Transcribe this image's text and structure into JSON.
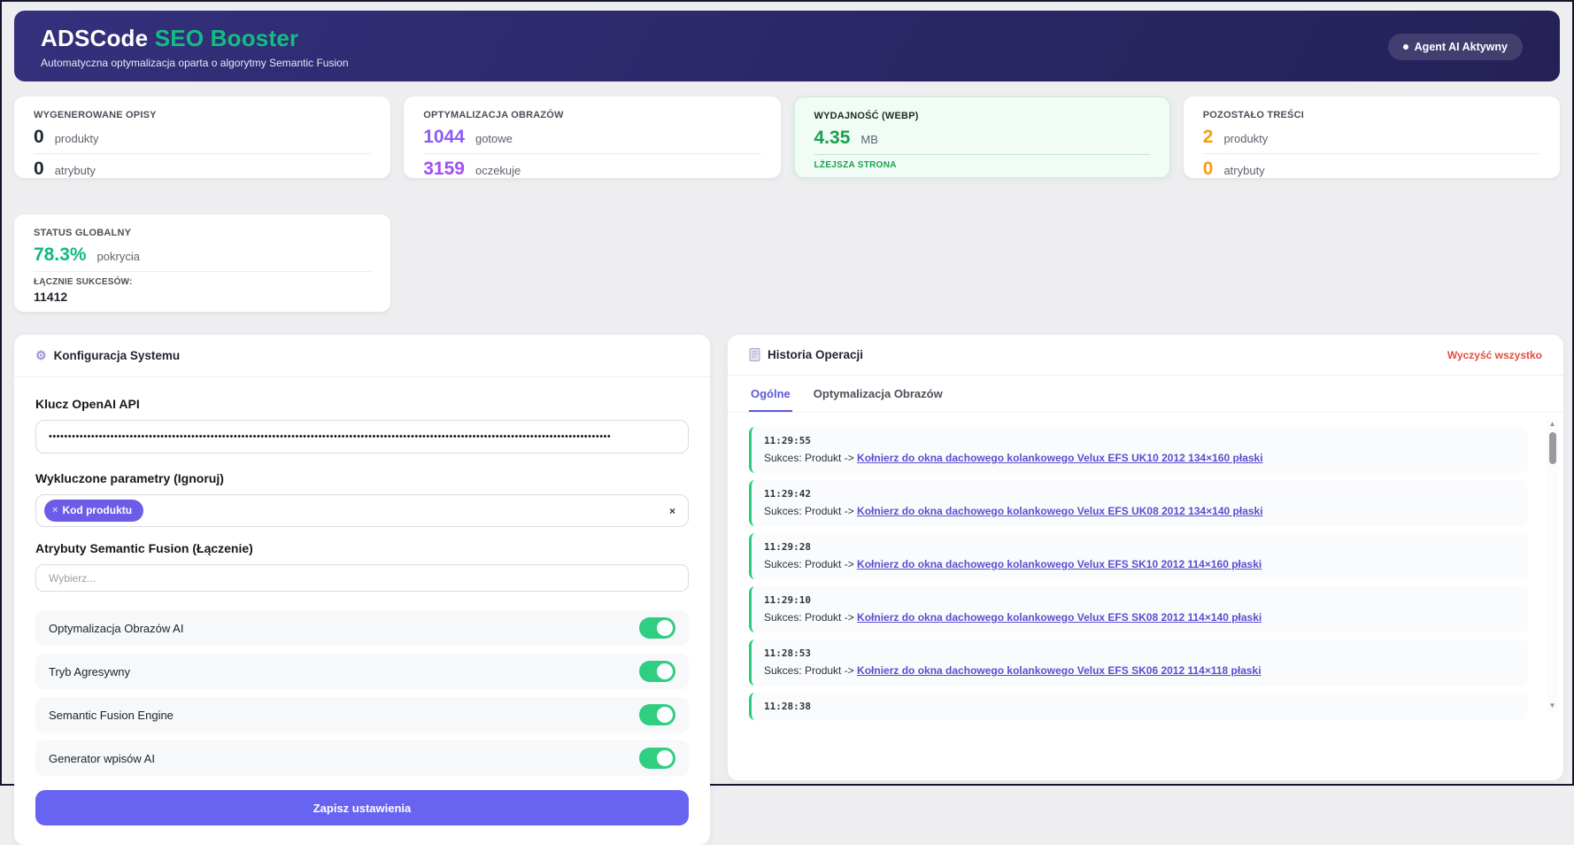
{
  "header": {
    "brand": "ADSCode",
    "brand_accent": "SEO Booster",
    "subtitle": "Automatyczna optymalizacja oparta o algorytmy Semantic Fusion",
    "badge": "Agent AI Aktywny"
  },
  "stats": [
    {
      "label": "WYGENEROWANE OPISY",
      "rows": [
        {
          "value": "0",
          "unit": "produkty"
        },
        {
          "value": "0",
          "unit": "atrybuty"
        }
      ]
    },
    {
      "label": "OPTYMALIZACJA OBRAZÓW",
      "rows": [
        {
          "value": "1044",
          "unit": "gotowe"
        },
        {
          "value": "3159",
          "unit": "oczekuje"
        }
      ]
    },
    {
      "label": "WYDAJNOŚĆ (WEBP)",
      "rows": [
        {
          "value": "4.35",
          "unit": "MB"
        }
      ],
      "footer": "LŻEJSZA STRONA"
    },
    {
      "label": "POZOSTAŁO TREŚCI",
      "rows": [
        {
          "value": "2",
          "unit": "produkty"
        },
        {
          "value": "0",
          "unit": "atrybuty"
        }
      ]
    }
  ],
  "status_card": {
    "label": "STATUS GLOBALNY",
    "value": "78.3%",
    "unit": "pokrycia",
    "total_label": "ŁĄCZNIE SUKCESÓW:",
    "total_value": "11412"
  },
  "config": {
    "title": "Konfiguracja Systemu",
    "gear_glyph": "⚙",
    "api_key_label": "Klucz OpenAI API",
    "api_key_masked": "••••••••••••••••••••••••••••••••••••••••••••••••••••••••••••••••••••••••••••••••••••••••••••••••••••••••••••••••••••••••••••••••••••••••••••••••••",
    "excluded_label": "Wykluczone parametry (Ignoruj)",
    "excluded_tag": "Kod produktu",
    "tag_remove_glyph": "×",
    "clear_glyph": "×",
    "fusion_label": "Atrybuty Semantic Fusion (Łączenie)",
    "fusion_placeholder": "Wybierz...",
    "toggles": [
      {
        "label": "Optymalizacja Obrazów AI",
        "on": true
      },
      {
        "label": "Tryb Agresywny",
        "on": true
      },
      {
        "label": "Semantic Fusion Engine",
        "on": true
      },
      {
        "label": "Generator wpisów AI",
        "on": true
      }
    ],
    "save_button": "Zapisz ustawienia"
  },
  "history": {
    "title": "Historia Operacji",
    "clear_all": "Wyczyść wszystko",
    "tabs": [
      {
        "label": "Ogólne",
        "active": true
      },
      {
        "label": "Optymalizacja Obrazów",
        "active": false
      }
    ],
    "entries": [
      {
        "time": "11:29:55",
        "prefix": "Sukces: Produkt -> ",
        "link": "Kołnierz do okna dachowego kolankowego Velux EFS UK10 2012 134×160 płaski"
      },
      {
        "time": "11:29:42",
        "prefix": "Sukces: Produkt -> ",
        "link": "Kołnierz do okna dachowego kolankowego Velux EFS UK08 2012 134×140 płaski"
      },
      {
        "time": "11:29:28",
        "prefix": "Sukces: Produkt -> ",
        "link": "Kołnierz do okna dachowego kolankowego Velux EFS SK10 2012 114×160 płaski"
      },
      {
        "time": "11:29:10",
        "prefix": "Sukces: Produkt -> ",
        "link": "Kołnierz do okna dachowego kolankowego Velux EFS SK08 2012 114×140 płaski"
      },
      {
        "time": "11:28:53",
        "prefix": "Sukces: Produkt -> ",
        "link": "Kołnierz do okna dachowego kolankowego Velux EFS SK06 2012 114×118 płaski"
      },
      {
        "time": "11:28:38"
      }
    ],
    "scroll_up_glyph": "▲",
    "scroll_down_glyph": "▼"
  },
  "colors": {
    "header_bg": "#2b2766",
    "brand_accent": "#12bd83",
    "purple_stat": "#8b5cf6",
    "green_stat": "#16a34a",
    "orange_stat": "#f59e0b",
    "teal_status": "#10b981",
    "toggle_on": "#2fce81",
    "button_primary": "#6764f2",
    "tag_bg": "#6c5ce7",
    "link": "#5a4ecf",
    "danger": "#e74c3c",
    "tab_active": "#5a5bd8"
  }
}
